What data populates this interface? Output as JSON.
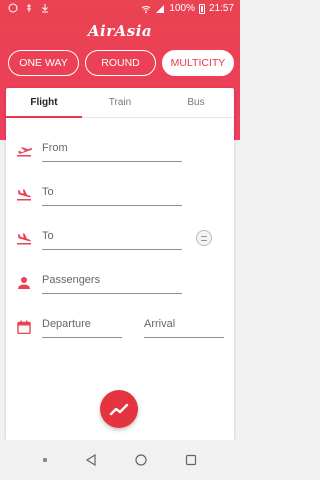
{
  "status_bar": {
    "battery": "100%",
    "time": "21:57"
  },
  "brand": {
    "logo_text": "AirAsia",
    "primary": "#e8384f"
  },
  "trip_types": [
    "ONE WAY",
    "ROUND",
    "MULTICITY"
  ],
  "selected_trip_type": "MULTICITY",
  "tabs": [
    "Flight",
    "Train",
    "Bus"
  ],
  "active_tab": "Flight",
  "form": {
    "from_placeholder": "From",
    "to1_placeholder": "To",
    "to2_placeholder": "To",
    "passengers_placeholder": "Passengers",
    "departure_placeholder": "Departure",
    "arrival_placeholder": "Arrival"
  },
  "icons": {
    "from": "plane-takeoff-icon",
    "to": "plane-landing-icon",
    "passengers": "person-icon",
    "date": "calendar-icon",
    "search": "trend-search-icon"
  }
}
